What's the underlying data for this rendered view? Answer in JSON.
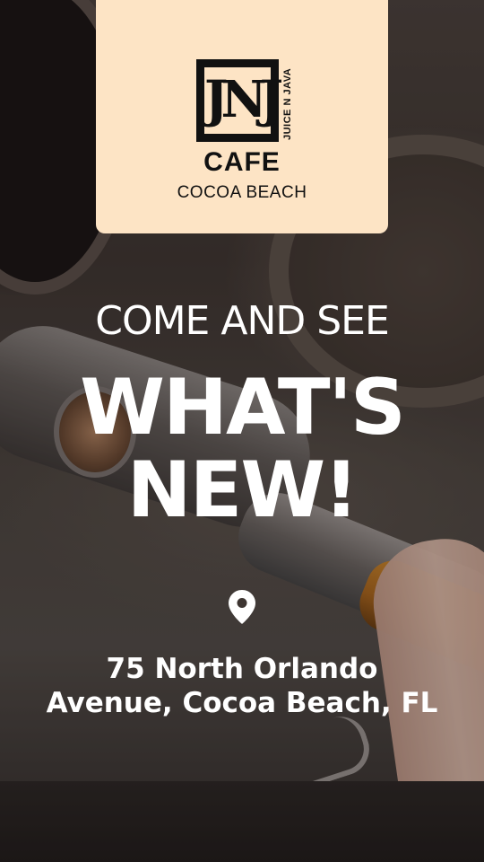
{
  "logo": {
    "letters": "JNJ",
    "vertical_text": "JUICE N JAVA",
    "title": "CAFE",
    "subtitle": "COCOA BEACH"
  },
  "headline": {
    "line_small": "COME AND SEE",
    "line_big_1": "WHAT'S",
    "line_big_2": "NEW!"
  },
  "location": {
    "icon": "location-pin-icon",
    "address_line1": "75 North Orlando",
    "address_line2": "Avenue, Cocoa Beach, FL"
  },
  "colors": {
    "card_bg": "#fde4c5",
    "text": "#ffffff",
    "logo_ink": "#111111"
  }
}
